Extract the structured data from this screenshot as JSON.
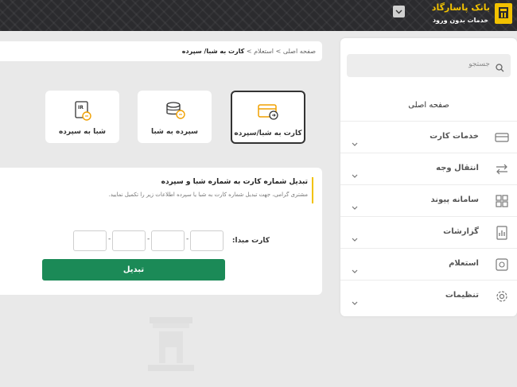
{
  "header": {
    "brand_name": "بانک پاسارگاد",
    "brand_subtitle": "خدمات بدون ورود"
  },
  "sidebar": {
    "search_placeholder": "جستجو",
    "home_label": "صفحه اصلی",
    "items": [
      {
        "label": "خدمات کارت",
        "icon": "card-icon"
      },
      {
        "label": "انتقال وجه",
        "icon": "transfer-icon"
      },
      {
        "label": "سامانه پیوند",
        "icon": "grid-icon"
      },
      {
        "label": "گزارشات",
        "icon": "report-icon"
      },
      {
        "label": "استعلام",
        "icon": "inquiry-icon"
      },
      {
        "label": "تنظیمات",
        "icon": "gear-icon"
      }
    ]
  },
  "breadcrumb": {
    "home": "صفحه اصلی",
    "sep1": ">",
    "section": "استعلام",
    "sep2": ">",
    "current": "کارت به شبا/ سپرده"
  },
  "services": [
    {
      "label": "کارت به شبا/سپرده",
      "icon": "card-to-iban-icon",
      "active": true
    },
    {
      "label": "سپرده به شبا",
      "icon": "deposit-to-iban-icon",
      "active": false
    },
    {
      "label": "شبا به سپرده",
      "icon": "iban-to-deposit-icon",
      "active": false
    }
  ],
  "form": {
    "title": "تبدیل شماره کارت به شماره شبا و سپرده",
    "description": "مشتری گرامی، جهت تبدیل شماره کارت به شبا یا سپرده اطلاعات زیر را تکمیل نمایید.",
    "card_label": "کارت مبدا:",
    "card_segments": [
      "",
      "",
      "",
      ""
    ],
    "submit_label": "تبدیل"
  },
  "colors": {
    "accent": "#f2c200",
    "button": "#1b8a57",
    "header_bg": "#2b2b2e"
  }
}
